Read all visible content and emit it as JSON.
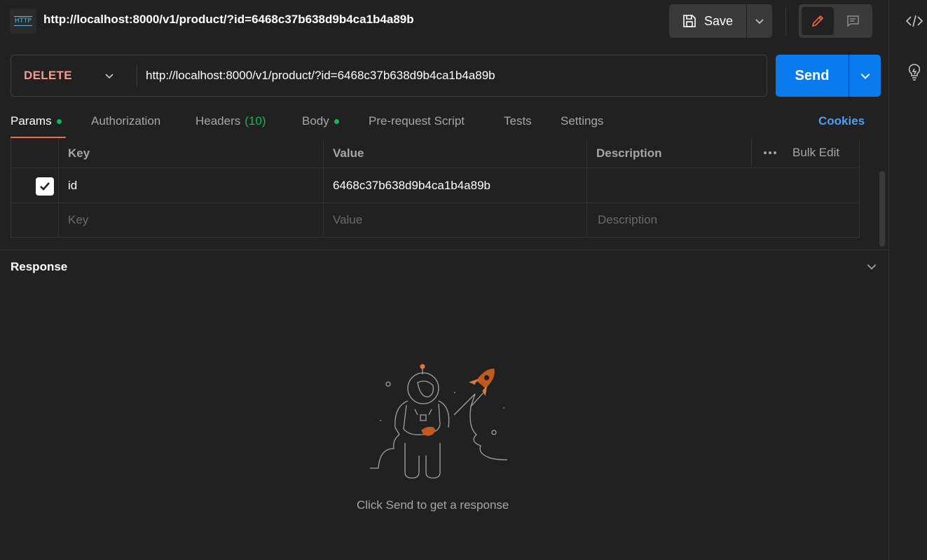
{
  "header": {
    "badge_text": "HTTP",
    "request_title": "http://localhost:8000/v1/product/?id=6468c37b638d9b4ca1b4a89b",
    "save_label": "Save"
  },
  "request": {
    "method": "DELETE",
    "method_color": "#f79a8e",
    "url": "http://localhost:8000/v1/product/?id=6468c37b638d9b4ca1b4a89b",
    "send_label": "Send",
    "send_color": "#097bed"
  },
  "tabs": [
    {
      "label": "Params",
      "active": true,
      "dot": true
    },
    {
      "label": "Authorization"
    },
    {
      "label": "Headers",
      "count": "(10)"
    },
    {
      "label": "Body",
      "dot": true
    },
    {
      "label": "Pre-request Script"
    },
    {
      "label": "Tests"
    },
    {
      "label": "Settings"
    }
  ],
  "cookies_label": "Cookies",
  "params": {
    "headers": {
      "key": "Key",
      "value": "Value",
      "description": "Description"
    },
    "bulk_edit_label": "Bulk Edit",
    "rows": [
      {
        "checked": true,
        "key": "id",
        "value": "6468c37b638d9b4ca1b4a89b",
        "description": ""
      }
    ],
    "placeholders": {
      "key": "Key",
      "value": "Value",
      "description": "Description"
    }
  },
  "response": {
    "title": "Response",
    "empty_hint": "Click Send to get a response"
  },
  "icons": {
    "sidebar": [
      "code-icon",
      "lightbulb-icon"
    ],
    "accent_orange": "#f26b3a",
    "status_green": "#0cbb52",
    "link_blue": "#4d9ff4"
  }
}
